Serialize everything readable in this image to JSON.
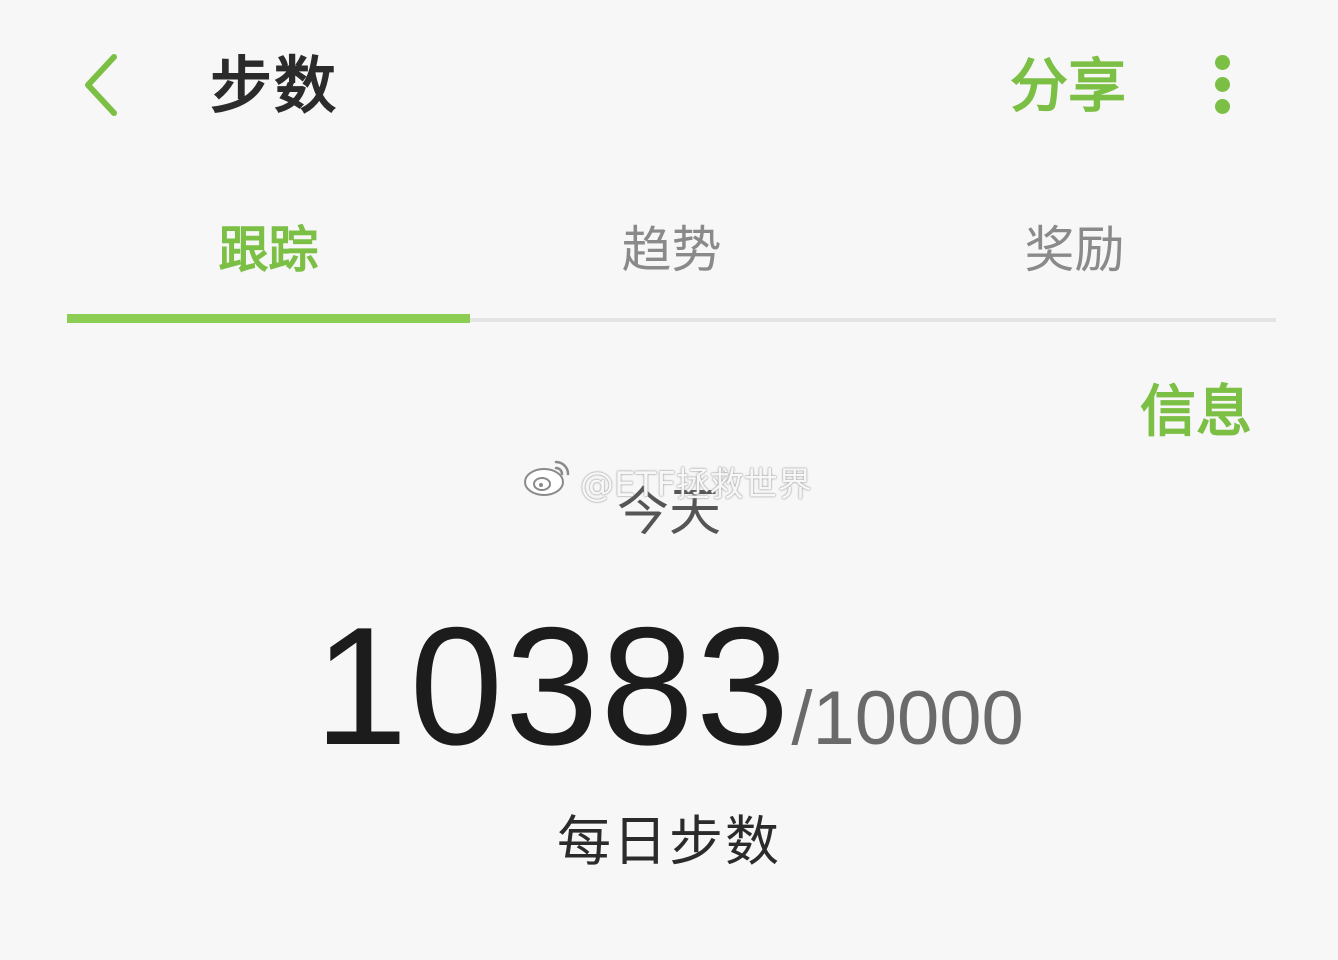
{
  "app_bar": {
    "title": "步数",
    "share_label": "分享",
    "back_icon": "chevron-left-icon",
    "more_icon": "more-vertical-icon"
  },
  "tabs": [
    {
      "label": "跟踪",
      "active": true
    },
    {
      "label": "趋势",
      "active": false
    },
    {
      "label": "奖励",
      "active": false
    }
  ],
  "info_label": "信息",
  "watermark": {
    "icon": "weibo-icon",
    "text": "@ETF拯救世界"
  },
  "summary": {
    "day_label": "今天",
    "steps": "10383",
    "goal": "/10000",
    "caption": "每日步数"
  },
  "colors": {
    "accent": "#7bbf45",
    "indicator": "#8ccd54",
    "background": "#f7f7f7",
    "text_primary": "#1c1c1c",
    "text_secondary": "#8a8a8a"
  }
}
